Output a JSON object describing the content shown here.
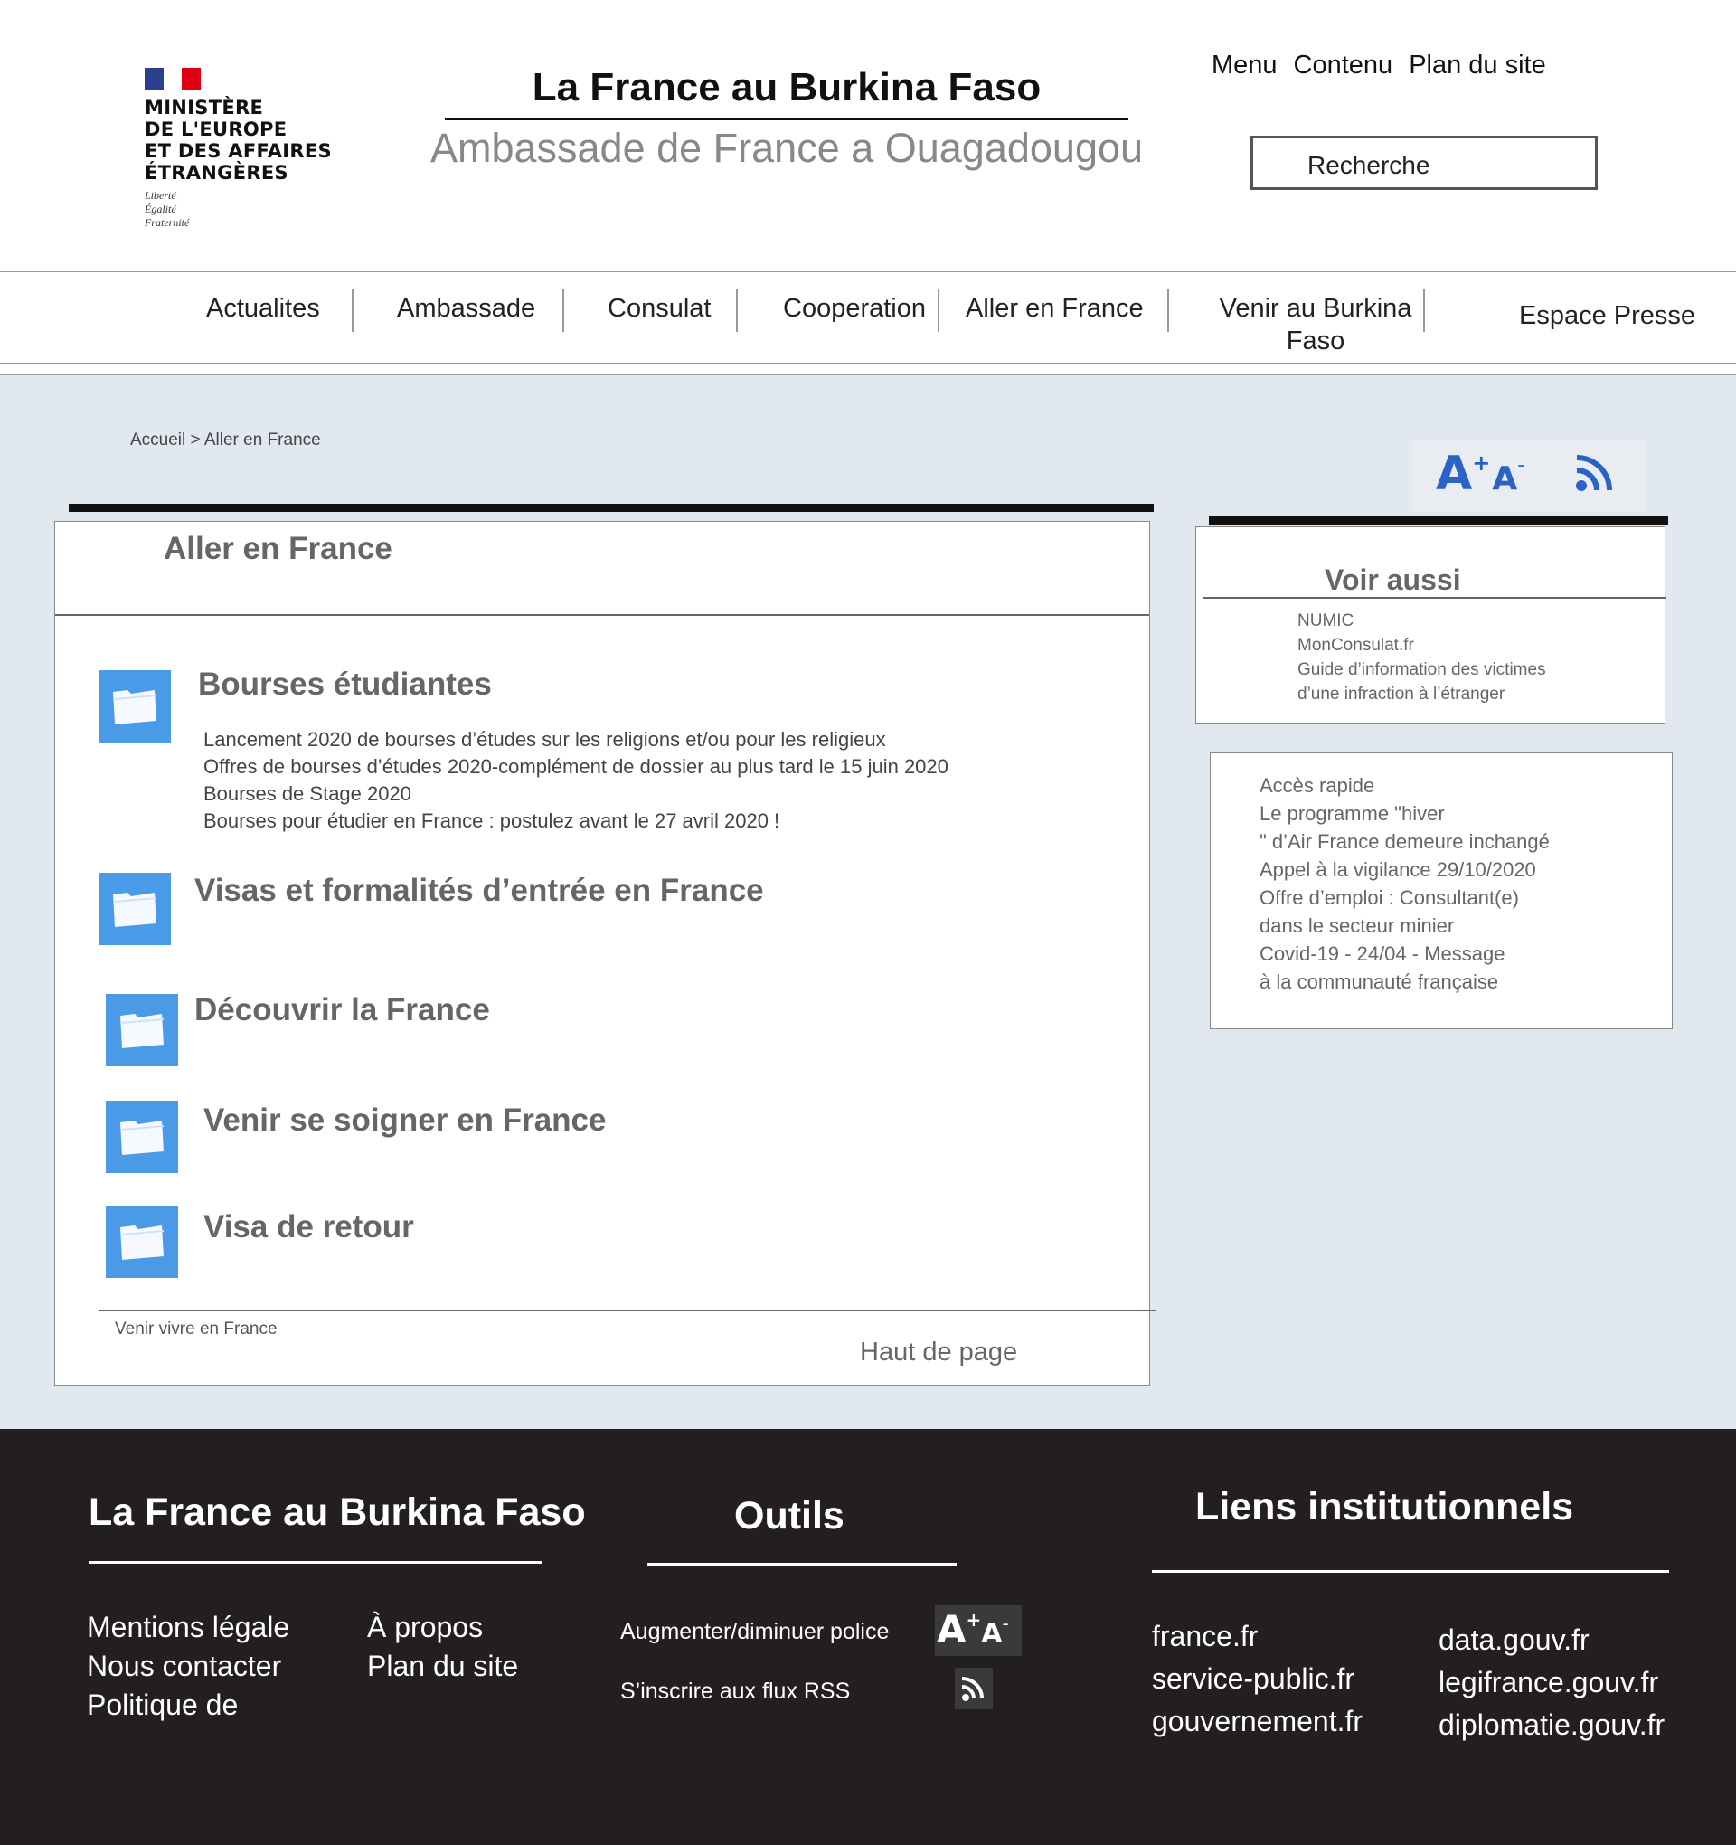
{
  "header": {
    "logo_lines": [
      "MINISTÈRE",
      "DE L'EUROPE",
      "ET DES AFFAIRES",
      "ÉTRANGÈRES"
    ],
    "motto_lines": [
      "Liberté",
      "Égalité",
      "Fraternité"
    ],
    "site_title": "La France au Burkina Faso",
    "site_subtitle": "Ambassade de France a Ouagadougou",
    "quick_links": [
      "Menu",
      "Contenu",
      "Plan du site"
    ],
    "search_placeholder": "Recherche"
  },
  "nav": {
    "items": [
      "Actualites",
      "Ambassade",
      "Consulat",
      "Cooperation",
      "Aller en France",
      "Venir au Burkina",
      "Faso",
      "Espace Presse"
    ]
  },
  "breadcrumb": {
    "home": "Accueil",
    "separator": ">",
    "current": "Aller en France"
  },
  "main": {
    "title": "Aller en France",
    "sections": [
      {
        "title": "Bourses étudiantes",
        "links": [
          "Lancement 2020 de bourses d’études sur les religions et/ou pour les religieux",
          "Offres de bourses d’études 2020-complément de dossier au plus tard le 15 juin 2020",
          "Bourses de Stage 2020",
          "Bourses pour étudier en France : postulez avant le 27 avril 2020 !"
        ]
      },
      {
        "title": "Visas et formalités d’entrée en France"
      },
      {
        "title": "Découvrir la France"
      },
      {
        "title": "Venir se soigner en France"
      },
      {
        "title": "Visa de retour"
      }
    ],
    "bottom_link": "Venir vivre en France",
    "top_link": "Haut de page"
  },
  "sidebar": {
    "voir_aussi": {
      "title": "Voir aussi",
      "links": [
        "NUMIC",
        "MonConsulat.fr",
        "Guide d’information des victimes",
        " d’une infraction à l’étranger"
      ]
    },
    "acces_rapide": {
      "lines": [
        "Accès rapide",
        "Le programme \"hiver",
        "\" d’Air France demeure inchangé",
        "Appel à la vigilance 29/10/2020",
        "Offre d’emploi : Consultant(e)",
        " dans le secteur minier",
        "Covid-19 - 24/04 - Message",
        " à la communauté française"
      ]
    }
  },
  "tools": {
    "font_big": "A",
    "font_plus": "+",
    "font_small": "A",
    "font_minus": "-"
  },
  "footer": {
    "col1_title": "La France au Burkina Faso",
    "col1_links_a": [
      "Mentions légale",
      "Nous contacter",
      "Politique de"
    ],
    "col1_links_b": [
      "À propos",
      "Plan du site"
    ],
    "col2_title": "Outils",
    "tool_font_label": "Augmenter/diminuer police",
    "tool_rss_label": "S’inscrire aux flux RSS",
    "col3_title": "Liens institutionnels",
    "col3_links_a": [
      "france.fr",
      "service-public.fr",
      "gouvernement.fr"
    ],
    "col3_links_b": [
      "data.gouv.fr",
      "legifrance.gouv.fr",
      "diplomatie.gouv.fr"
    ]
  },
  "colors": {
    "accent_blue": "#4b9ae8",
    "tool_blue": "#2a63c6",
    "page_bg": "#e1e8ef",
    "footer_bg": "#231f20",
    "flag_blue": "#2b3f8f",
    "flag_red": "#e1000f"
  }
}
